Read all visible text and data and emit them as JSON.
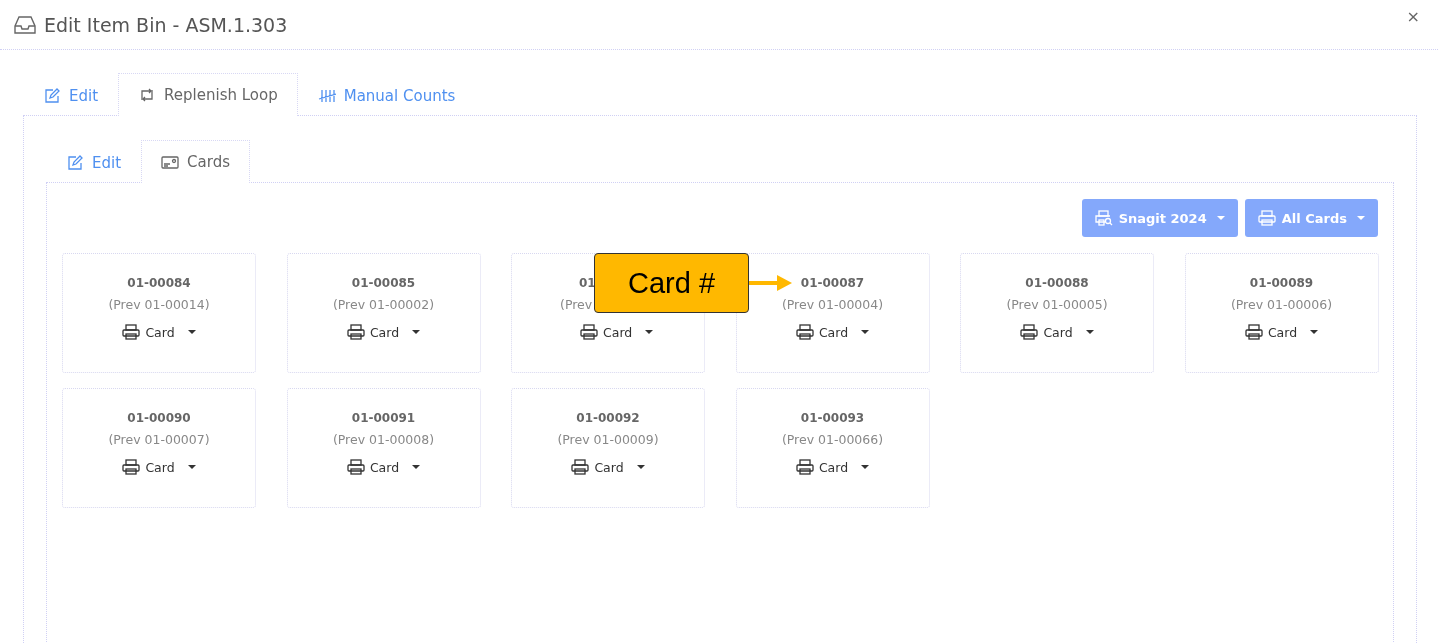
{
  "window": {
    "title": "Edit Item Bin - ASM.1.303",
    "close": "×"
  },
  "tabs": [
    {
      "label": "Edit",
      "kind": "edit",
      "selected": false
    },
    {
      "label": "Replenish Loop",
      "kind": "loop",
      "selected": true
    },
    {
      "label": "Manual Counts",
      "kind": "tally",
      "selected": false
    }
  ],
  "subtabs": [
    {
      "label": "Edit",
      "kind": "edit",
      "selected": false
    },
    {
      "label": "Cards",
      "kind": "card",
      "selected": true
    }
  ],
  "toolbar": [
    {
      "label": "Snagit 2024",
      "kind": "printer-search"
    },
    {
      "label": "All Cards",
      "kind": "printer"
    }
  ],
  "cards": [
    {
      "number": "01-00084",
      "prev": "(Prev 01-00014)",
      "action": "Card"
    },
    {
      "number": "01-00085",
      "prev": "(Prev 01-00002)",
      "action": "Card"
    },
    {
      "number": "01",
      "prev": "(Prev",
      "action": "Card",
      "covered": true
    },
    {
      "number": "01-00087",
      "prev": "(Prev 01-00004)",
      "action": "Card"
    },
    {
      "number": "01-00088",
      "prev": "(Prev 01-00005)",
      "action": "Card"
    },
    {
      "number": "01-00089",
      "prev": "(Prev 01-00006)",
      "action": "Card"
    },
    {
      "number": "01-00090",
      "prev": "(Prev 01-00007)",
      "action": "Card"
    },
    {
      "number": "01-00091",
      "prev": "(Prev 01-00008)",
      "action": "Card"
    },
    {
      "number": "01-00092",
      "prev": "(Prev 01-00009)",
      "action": "Card"
    },
    {
      "number": "01-00093",
      "prev": "(Prev 01-00066)",
      "action": "Card"
    }
  ],
  "callout": {
    "text": "Card #"
  }
}
